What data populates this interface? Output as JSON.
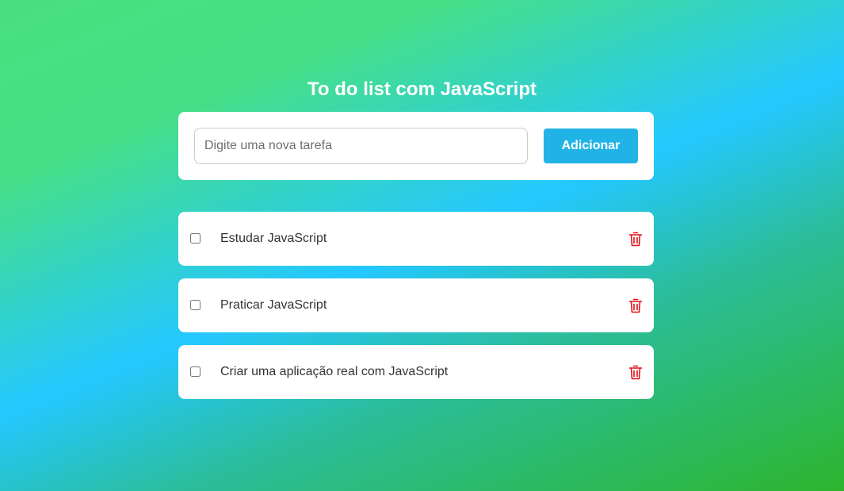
{
  "header": {
    "title": "To do list com JavaScript"
  },
  "form": {
    "input_value": "",
    "input_placeholder": "Digite uma nova tarefa",
    "add_button_label": "Adicionar"
  },
  "tasks": [
    {
      "label": "Estudar JavaScript",
      "completed": false
    },
    {
      "label": "Praticar JavaScript",
      "completed": false
    },
    {
      "label": "Criar uma aplicação real com JavaScript",
      "completed": false
    }
  ],
  "icons": {
    "delete": "trash-icon"
  },
  "colors": {
    "accent": "#22b3e6",
    "delete": "#e0101a",
    "card": "#ffffff"
  }
}
